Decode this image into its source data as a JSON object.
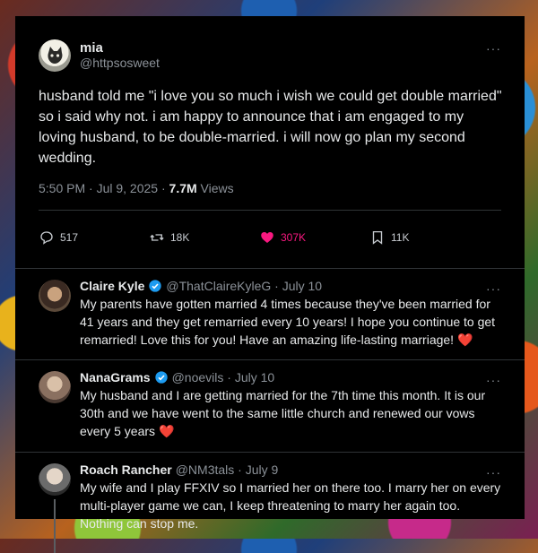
{
  "tweet": {
    "name": "mia",
    "handle": "@httpsosweet",
    "more_label": "···",
    "text": "husband told me \"i love you so much i wish we could get double married\" so i said why not. i am happy to announce that i am engaged to my loving husband, to be double-married. i will now go plan my second wedding.",
    "time": "5:50 PM · Jul 9, 2025 · ",
    "views_count": "7.7M",
    "views_label": " Views",
    "stats": {
      "replies": "517",
      "reposts": "18K",
      "likes": "307K",
      "bookmarks": "11K"
    }
  },
  "replies": [
    {
      "name": "Claire Kyle",
      "verified": true,
      "handle_date": "@ThatClaireKyleG · July 10",
      "text": "My parents have gotten married 4 times because they've been married for 41 years and they get remarried every 10 years! I hope you continue to get remarried! Love this for you! Have an amazing life-lasting marriage!",
      "emoji": "❤️"
    },
    {
      "name": "NanaGrams",
      "verified": true,
      "handle_date": "@noevils · July 10",
      "text": "My husband and I are getting married for the 7th time this month. It is our 30th and we have went to the same little church and renewed our vows every 5 years",
      "emoji": "❤️"
    },
    {
      "name": "Roach Rancher",
      "verified": false,
      "handle_date": "@NM3tals · July 9",
      "text": "My wife and I play FFXIV so I married her on there too. I marry her on every multi-player game we can, I keep threatening to marry her again too. Nothing can stop me.",
      "emoji": ""
    }
  ],
  "colors": {
    "background": "#000000",
    "text": "#e7e9ea",
    "secondary": "#8b9198",
    "like": "#f91880",
    "verified": "#1d9bf0"
  }
}
